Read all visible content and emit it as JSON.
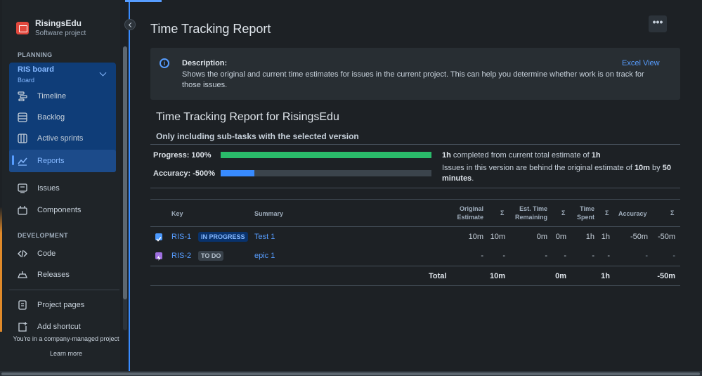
{
  "project": {
    "name": "RisingsEdu",
    "type": "Software project"
  },
  "sidebar": {
    "planning_header": "PLANNING",
    "board": {
      "title": "RIS board",
      "subtitle": "Board"
    },
    "board_items": [
      {
        "label": "Timeline",
        "icon": "timeline-icon"
      },
      {
        "label": "Backlog",
        "icon": "backlog-icon"
      },
      {
        "label": "Active sprints",
        "icon": "sprints-icon"
      },
      {
        "label": "Reports",
        "icon": "reports-icon"
      }
    ],
    "items": [
      {
        "label": "Issues",
        "icon": "issues-icon"
      },
      {
        "label": "Components",
        "icon": "components-icon"
      }
    ],
    "development_header": "DEVELOPMENT",
    "dev_items": [
      {
        "label": "Code",
        "icon": "code-icon"
      },
      {
        "label": "Releases",
        "icon": "releases-icon"
      }
    ],
    "bottom_items": [
      {
        "label": "Project pages",
        "icon": "page-icon"
      },
      {
        "label": "Add shortcut",
        "icon": "add-shortcut-icon"
      }
    ],
    "footer_text": "You're in a company-managed project",
    "learn_more": "Learn more"
  },
  "page": {
    "title": "Time Tracking Report",
    "more_label": "•••",
    "description": {
      "label": "Description:",
      "text": "Shows the original and current time estimates for issues in the current project. This can help you determine whether work is on track for those issues.",
      "excel_view": "Excel View"
    },
    "report_title": "Time Tracking Report for RisingsEdu",
    "sub_title": "Only including sub-tasks with the selected version",
    "progress": {
      "label": "Progress: 100%",
      "fraction": 1.0,
      "color": "#2abb6a",
      "text_bold_a": "1h",
      "text_mid": " completed from current total estimate of ",
      "text_bold_b": "1h"
    },
    "accuracy": {
      "label": "Accuracy: -500%",
      "fraction": 0.16,
      "color": "#388bff",
      "text_a": "Issues in this version are behind the original estimate of ",
      "text_bold_a": "10m",
      "text_b": " by ",
      "text_bold_b": "50 minutes",
      "text_c": "."
    },
    "table": {
      "headers": {
        "key": "Key",
        "summary": "Summary",
        "original_estimate": "Original Estimate",
        "sigma": "Σ",
        "est_remaining": "Est. Time Remaining",
        "time_spent": "Time Spent",
        "accuracy": "Accuracy"
      },
      "rows": [
        {
          "type": "task",
          "key": "RIS-1",
          "status": "IN PROGRESS",
          "summary": "Test 1",
          "orig": "10m",
          "orig_sum": "10m",
          "rem": "0m",
          "rem_sum": "0m",
          "spent": "1h",
          "spent_sum": "1h",
          "acc": "-50m",
          "acc_sum": "-50m"
        },
        {
          "type": "epic",
          "key": "RIS-2",
          "status": "TO DO",
          "summary": "epic 1",
          "orig": "-",
          "orig_sum": "-",
          "rem": "-",
          "rem_sum": "-",
          "spent": "-",
          "spent_sum": "-",
          "acc": "-",
          "acc_sum": "-"
        }
      ],
      "total": {
        "label": "Total",
        "orig": "10m",
        "rem": "0m",
        "spent": "1h",
        "acc": "-50m"
      }
    }
  }
}
